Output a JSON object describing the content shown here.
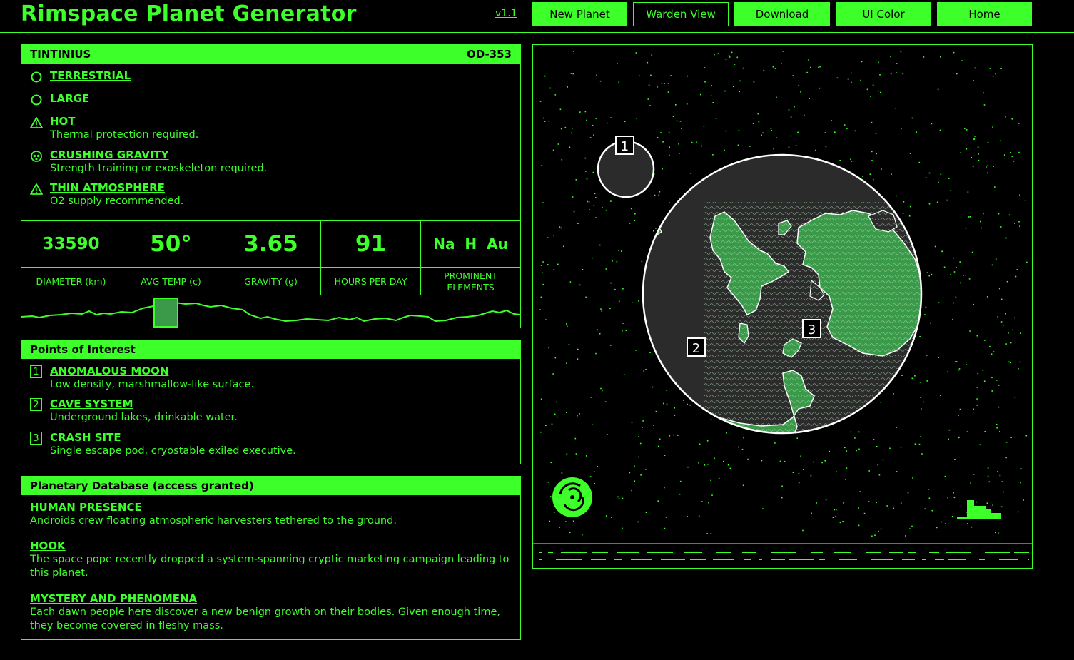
{
  "header": {
    "title": "Rimspace Planet Generator",
    "version": "v1.1",
    "buttons": [
      {
        "label": "New Planet"
      },
      {
        "label": "Warden View"
      },
      {
        "label": "Download"
      },
      {
        "label": "UI Color"
      },
      {
        "label": "Home"
      }
    ]
  },
  "planet": {
    "name": "TINTINIUS",
    "code": "OD-353",
    "traits": [
      {
        "title": "TERRESTRIAL",
        "desc": "",
        "icon": "circle-icon"
      },
      {
        "title": "LARGE",
        "desc": "",
        "icon": "circle-icon"
      },
      {
        "title": "HOT",
        "desc": "Thermal protection required.",
        "icon": "warning-icon"
      },
      {
        "title": "CRUSHING GRAVITY",
        "desc": "Strength training or exoskeleton required.",
        "icon": "skull-icon"
      },
      {
        "title": "THIN ATMOSPHERE",
        "desc": "O2 supply recommended.",
        "icon": "warning-icon"
      }
    ],
    "stats": [
      {
        "value": "33590",
        "label": "DIAMETER (km)"
      },
      {
        "value": "50°",
        "label": "AVG TEMP (c)"
      },
      {
        "value": "3.65",
        "label": "GRAVITY (g)"
      },
      {
        "value": "91",
        "label": "HOURS PER DAY"
      },
      {
        "value": "Na  H  Au",
        "label": "PROMINENT ELEMENTS"
      }
    ]
  },
  "poi": {
    "heading": "Points of Interest",
    "items": [
      {
        "num": "1",
        "title": "ANOMALOUS MOON",
        "desc": "Low density, marshmallow-like surface."
      },
      {
        "num": "2",
        "title": "CAVE SYSTEM",
        "desc": "Underground lakes, drinkable water."
      },
      {
        "num": "3",
        "title": "CRASH SITE",
        "desc": "Single escape pod, cryostable exiled executive."
      }
    ]
  },
  "database": {
    "heading": "Planetary Database (access granted)",
    "items": [
      {
        "title": "HUMAN PRESENCE",
        "desc": "Androids crew floating atmospheric harvesters tethered to the ground."
      },
      {
        "title": "HOOK",
        "desc": "The space pope recently dropped a system-spanning cryptic marketing campaign leading to this planet."
      },
      {
        "title": "MYSTERY AND PHENOMENA",
        "desc": "Each dawn people here discover a new benign growth on their bodies. Given enough time, they become covered in fleshy mass."
      }
    ]
  },
  "map": {
    "markers": [
      "1",
      "2",
      "3"
    ]
  },
  "colors": {
    "accent": "#3dff2a",
    "background": "#000000",
    "planet": "#2b2b2b",
    "land": "#3a9a4a"
  }
}
